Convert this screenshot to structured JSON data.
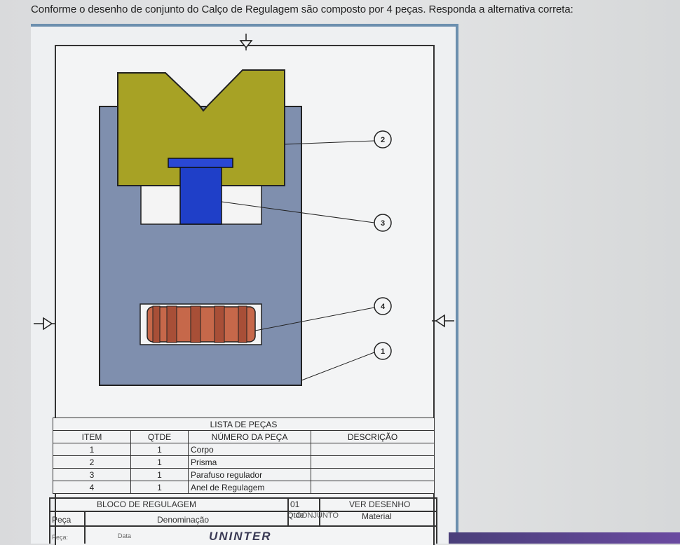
{
  "question": "Conforme o desenho de conjunto do Calço de Regulagem são composto por 4 peças. Responda a alternativa correta:",
  "callouts": [
    "2",
    "3",
    "4",
    "1"
  ],
  "parts_list": {
    "title": "LISTA DE PEÇAS",
    "headers": [
      "ITEM",
      "QTDE",
      "NÚMERO DA PEÇA",
      "DESCRIÇÃO"
    ],
    "rows": [
      {
        "item": "1",
        "qty": "1",
        "name": "Corpo",
        "desc": ""
      },
      {
        "item": "2",
        "qty": "1",
        "name": "Prisma",
        "desc": ""
      },
      {
        "item": "3",
        "qty": "1",
        "name": "Parafuso regulador",
        "desc": ""
      },
      {
        "item": "4",
        "qty": "1",
        "name": "Anel de Regulagem",
        "desc": ""
      }
    ]
  },
  "title_block": {
    "name": "BLOCO DE REGULAGEM",
    "qty": "01",
    "see": "VER DESENHO",
    "label_peca": "Peça",
    "label_denom": "Denominação",
    "label_qtde": "Qtde",
    "label_conjunto": "CONJUNTO",
    "label_material": "Material",
    "label_peca_small": "Peça:",
    "label_data": "Data",
    "logo": "UNINTER"
  },
  "colors": {
    "body": "#7f8fae",
    "prism": "#a7a225",
    "screw": "#2a48d4",
    "ring": "#c6684a"
  }
}
